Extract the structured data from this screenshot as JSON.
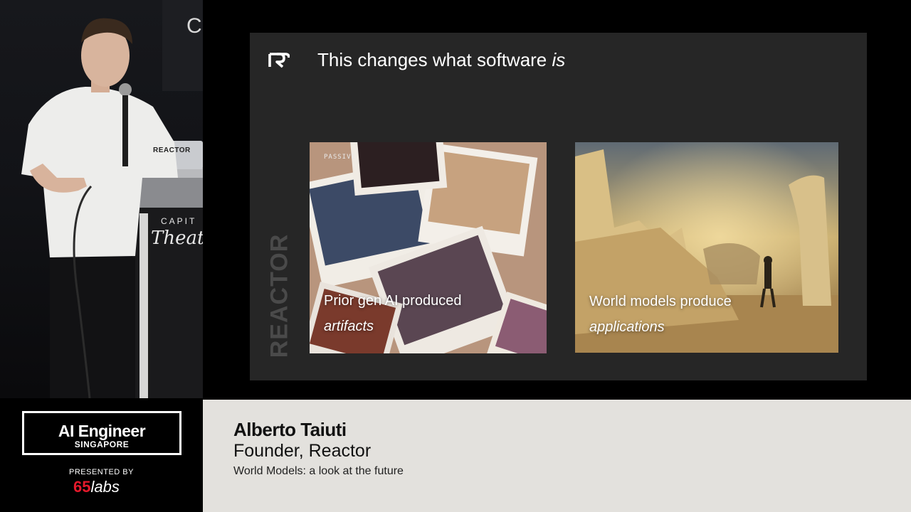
{
  "speaker_video": {
    "screen_corner_text": "C",
    "laptop_label": "REACTOR",
    "lectern_sign_top": "CAPIT",
    "lectern_sign_script": "Theat"
  },
  "slide": {
    "title_main": "This changes what software ",
    "title_emphasis": "is",
    "vertical_brand": "REACTOR",
    "cards": [
      {
        "tag": "PASSIVE",
        "caption_line1": "Prior gen AI produced",
        "caption_line2": "artifacts"
      },
      {
        "caption_line1": "World models produce",
        "caption_line2": "applications"
      }
    ]
  },
  "lower_third": {
    "event_name": "AI Engineer",
    "event_location": "SINGAPORE",
    "presented_by": "PRESENTED BY",
    "sponsor_number": "65",
    "sponsor_word": "labs",
    "speaker_name": "Alberto Taiuti",
    "speaker_role": "Founder, Reactor",
    "talk_title": "World Models: a look at the future"
  }
}
